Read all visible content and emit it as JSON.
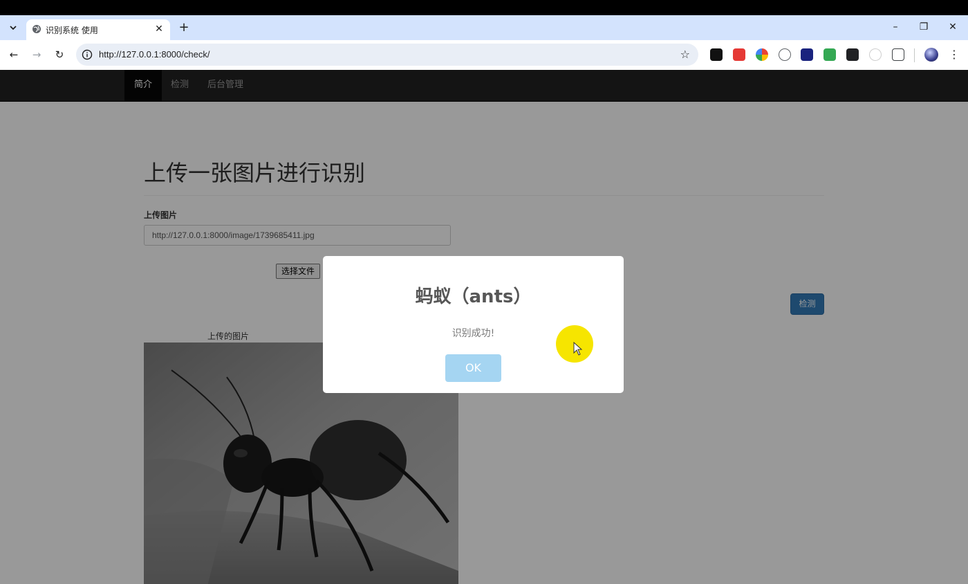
{
  "browser": {
    "tab_title": "识别系统 使用",
    "tab_close": "✕",
    "new_tab": "+",
    "url": "http://127.0.0.1:8000/check/",
    "window_controls": {
      "minimize": "–",
      "restore": "❐",
      "close": "✕"
    },
    "nav": {
      "back": "←",
      "forward": "→",
      "reload": "↻"
    },
    "star": "☆",
    "menu": "⋮",
    "extensions": [
      {
        "name": "dots-extension-icon",
        "color": "#111111"
      },
      {
        "name": "hand-extension-icon",
        "color": "#e53935"
      },
      {
        "name": "ring-extension-icon",
        "color": "#fbbc05"
      },
      {
        "name": "braces-extension-icon",
        "color": "#5f6368"
      },
      {
        "name": "hexagon-extension-icon",
        "color": "#1a237e"
      },
      {
        "name": "play-extension-icon",
        "color": "#34a853"
      },
      {
        "name": "clapper-extension-icon",
        "color": "#202124"
      },
      {
        "name": "fan-extension-icon",
        "color": "#9e9e9e"
      },
      {
        "name": "puzzle-extension-icon",
        "color": "#3c4043"
      }
    ]
  },
  "site": {
    "nav_items": [
      {
        "label": "简介",
        "active": true
      },
      {
        "label": "检测",
        "active": false
      },
      {
        "label": "后台管理",
        "active": false
      }
    ],
    "heading": "上传一张图片进行识别",
    "upload_label": "上传图片",
    "image_url_value": "http://127.0.0.1:8000/image/1739685411.jpg",
    "choose_file_label": "选择文件",
    "detect_button": "检测",
    "uploaded_caption": "上传的图片"
  },
  "dialog": {
    "title": "蚂蚁（ants）",
    "message": "识别成功!",
    "ok_label": "OK"
  },
  "colors": {
    "primary_button": "#337ab7",
    "ok_button": "#a5d5f2",
    "navbar": "#222222",
    "cursor_highlight": "#f6e500"
  }
}
